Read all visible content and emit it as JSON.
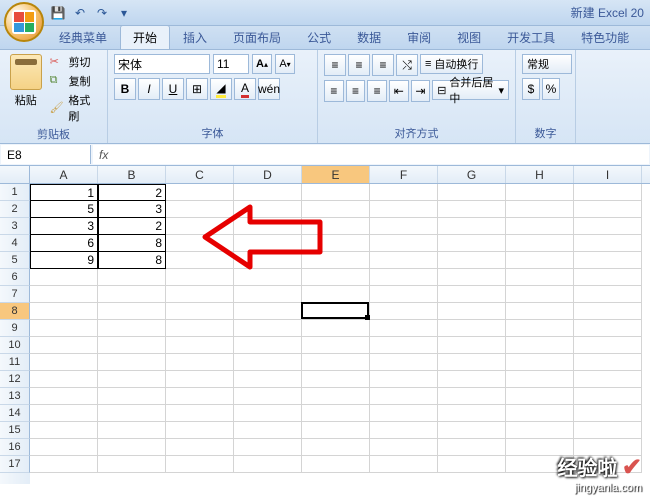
{
  "app": {
    "title": "新建 Excel 20"
  },
  "tabs": {
    "classic": "经典菜单",
    "home": "开始",
    "insert": "插入",
    "layout": "页面布局",
    "formula": "公式",
    "data": "数据",
    "review": "审阅",
    "view": "视图",
    "dev": "开发工具",
    "special": "特色功能"
  },
  "clipboard": {
    "paste": "粘贴",
    "cut": "剪切",
    "copy": "复制",
    "brush": "格式刷",
    "group_label": "剪贴板"
  },
  "font": {
    "name": "宋体",
    "size": "11",
    "grow": "A",
    "shrink": "A",
    "bold": "B",
    "italic": "I",
    "underline": "U",
    "group_label": "字体"
  },
  "align": {
    "wrap": "自动换行",
    "merge": "合并后居中",
    "group_label": "对齐方式"
  },
  "number": {
    "general": "常规",
    "group_label": "数字"
  },
  "namebox": {
    "value": "E8"
  },
  "formula": {
    "fx": "fx",
    "value": ""
  },
  "columns": [
    "A",
    "B",
    "C",
    "D",
    "E",
    "F",
    "G",
    "H",
    "I"
  ],
  "rows_count": 17,
  "selected": {
    "col": "E",
    "row": 8
  },
  "chart_data": {
    "type": "table",
    "columns": [
      "A",
      "B"
    ],
    "rows": [
      {
        "A": 1,
        "B": 2
      },
      {
        "A": 5,
        "B": 3
      },
      {
        "A": 3,
        "B": 2
      },
      {
        "A": 6,
        "B": 8
      },
      {
        "A": 9,
        "B": 8
      }
    ]
  },
  "watermark": {
    "big": "经验啦",
    "url": "jingyanla.com"
  }
}
